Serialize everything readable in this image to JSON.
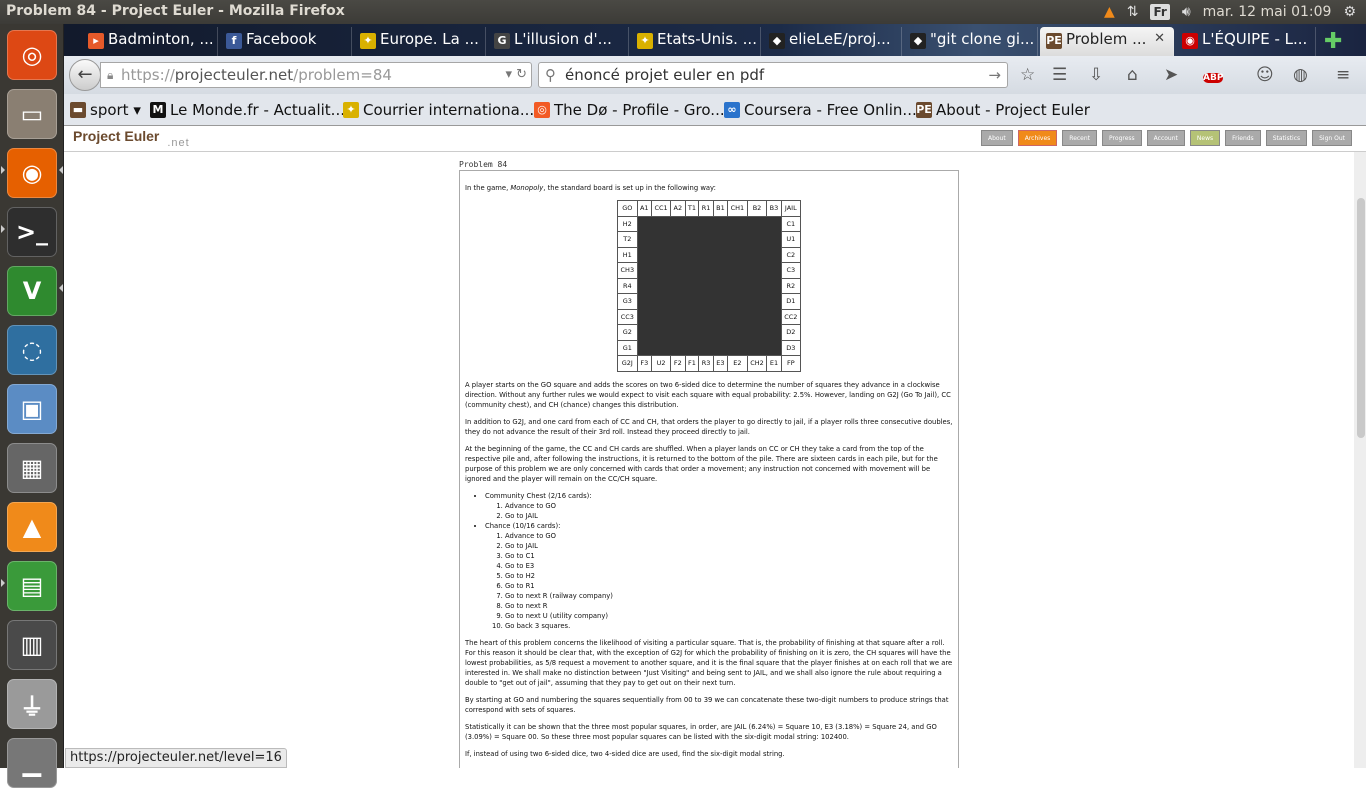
{
  "system": {
    "window_title": "Problem 84 - Project Euler - Mozilla Firefox",
    "keyboard": "Fr",
    "clock": "mar. 12 mai 01:09"
  },
  "launcher": [
    {
      "name": "ubuntu-dash-icon",
      "glyph": "◎",
      "bg": "#dd4814"
    },
    {
      "name": "files-icon",
      "glyph": "▭",
      "bg": "#8a7f72"
    },
    {
      "name": "firefox-icon",
      "glyph": "◉",
      "bg": "#e66000"
    },
    {
      "name": "terminal-icon",
      "glyph": ">_",
      "bg": "#2e2e2e"
    },
    {
      "name": "vim-icon",
      "glyph": "V",
      "bg": "#2f8a2f"
    },
    {
      "name": "network-icon",
      "glyph": "◌",
      "bg": "#2f6fa0"
    },
    {
      "name": "virtualbox-icon",
      "glyph": "▣",
      "bg": "#5b8cc4"
    },
    {
      "name": "calculator-icon",
      "glyph": "▦",
      "bg": "#666"
    },
    {
      "name": "vlc-icon",
      "glyph": "▲",
      "bg": "#f08a1a"
    },
    {
      "name": "spreadsheet-icon",
      "glyph": "▤",
      "bg": "#3a9a3a"
    },
    {
      "name": "workspaces-icon",
      "glyph": "▥",
      "bg": "#4a4a4a"
    },
    {
      "name": "usb-drive-icon",
      "glyph": "⏚",
      "bg": "#9a9a9a"
    },
    {
      "name": "trash-icon",
      "glyph": "▁",
      "bg": "#777"
    }
  ],
  "tabs": [
    {
      "label": "Badminton, ...",
      "fav": "▸",
      "favbg": "#e65a2a"
    },
    {
      "label": "Facebook",
      "fav": "f",
      "favbg": "#3b5998"
    },
    {
      "label": "Europe. La ...",
      "fav": "✦",
      "favbg": "#d9b100"
    },
    {
      "label": "L'illusion d'...",
      "fav": "G",
      "favbg": "#444"
    },
    {
      "label": "Etats-Unis. ...",
      "fav": "✦",
      "favbg": "#d9b100"
    },
    {
      "label": "elieLeE/proj...",
      "fav": "◆",
      "favbg": "#222"
    },
    {
      "label": "\"git clone gi...",
      "fav": "◆",
      "favbg": "#222"
    },
    {
      "label": "Problem ...",
      "fav": "PE",
      "favbg": "#6b4a2e"
    },
    {
      "label": "L'ÉQUIPE - L...",
      "fav": "◉",
      "favbg": "#c00"
    }
  ],
  "url": {
    "prefix": "https://",
    "host": "projecteuler.net",
    "path": "/problem=84"
  },
  "search": {
    "value": "énoncé projet euler en pdf"
  },
  "bookmarks": [
    {
      "label": "sport ▾",
      "fav": "▬",
      "favbg": "#6b4a2e"
    },
    {
      "label": "Le Monde.fr - Actualit...",
      "fav": "M",
      "favbg": "#111"
    },
    {
      "label": "Courrier internationa...",
      "fav": "✦",
      "favbg": "#d9b100"
    },
    {
      "label": "The Dø - Profile - Gro...",
      "fav": "◎",
      "favbg": "#f25a24"
    },
    {
      "label": "Coursera - Free Onlin...",
      "fav": "∞",
      "favbg": "#2a73cc"
    },
    {
      "label": "About - Project Euler",
      "fav": "PE",
      "favbg": "#6b4a2e"
    }
  ],
  "pe": {
    "logo": "Project Euler",
    "logo_net": ".net",
    "nav": [
      "About",
      "Archives",
      "Recent",
      "Progress",
      "Account",
      "News",
      "Friends",
      "Statistics",
      "Sign Out"
    ]
  },
  "problem": {
    "title": "Problem 84",
    "intro": "In the game, Monopoly, the standard board is set up in the following way:",
    "board": {
      "top": [
        "GO",
        "A1",
        "CC1",
        "A2",
        "T1",
        "R1",
        "B1",
        "CH1",
        "B2",
        "B3",
        "JAIL"
      ],
      "left": [
        "H2",
        "T2",
        "H1",
        "CH3",
        "R4",
        "G3",
        "CC3",
        "G2",
        "G1"
      ],
      "right": [
        "C1",
        "U1",
        "C2",
        "C3",
        "R2",
        "D1",
        "CC2",
        "D2",
        "D3"
      ],
      "bottom": [
        "G2J",
        "F3",
        "U2",
        "F2",
        "F1",
        "R3",
        "E3",
        "E2",
        "CH2",
        "E1",
        "FP"
      ]
    },
    "p1": "A player starts on the GO square and adds the scores on two 6-sided dice to determine the number of squares they advance in a clockwise direction. Without any further rules we would expect to visit each square with equal probability: 2.5%. However, landing on G2J (Go To Jail), CC (community chest), and CH (chance) changes this distribution.",
    "p2": "In addition to G2J, and one card from each of CC and CH, that orders the player to go directly to jail, if a player rolls three consecutive doubles, they do not advance the result of their 3rd roll. Instead they proceed directly to jail.",
    "p3": "At the beginning of the game, the CC and CH cards are shuffled. When a player lands on CC or CH they take a card from the top of the respective pile and, after following the instructions, it is returned to the bottom of the pile. There are sixteen cards in each pile, but for the purpose of this problem we are only concerned with cards that order a movement; any instruction not concerned with movement will be ignored and the player will remain on the CC/CH square.",
    "cc_title": "Community Chest (2/16 cards):",
    "cc_items": [
      "Advance to GO",
      "Go to JAIL"
    ],
    "ch_title": "Chance (10/16 cards):",
    "ch_items": [
      "Advance to GO",
      "Go to JAIL",
      "Go to C1",
      "Go to E3",
      "Go to H2",
      "Go to R1",
      "Go to next R (railway company)",
      "Go to next R",
      "Go to next U (utility company)",
      "Go back 3 squares."
    ],
    "p4": "The heart of this problem concerns the likelihood of visiting a particular square. That is, the probability of finishing at that square after a roll. For this reason it should be clear that, with the exception of G2J for which the probability of finishing on it is zero, the CH squares will have the lowest probabilities, as 5/8 request a movement to another square, and it is the final square that the player finishes at on each roll that we are interested in. We shall make no distinction between \"Just Visiting\" and being sent to JAIL, and we shall also ignore the rule about requiring a double to \"get out of jail\", assuming that they pay to get out on their next turn.",
    "p5": "By starting at GO and numbering the squares sequentially from 00 to 39 we can concatenate these two-digit numbers to produce strings that correspond with sets of squares.",
    "p6": "Statistically it can be shown that the three most popular squares, in order, are JAIL (6.24%) = Square 10, E3 (3.18%) = Square 24, and GO (3.09%) = Square 00. So these three most popular squares can be listed with the six-digit modal string: 102400.",
    "p7": "If, instead of using two 6-sided dice, two 4-sided dice are used, find the six-digit modal string."
  },
  "statusbar": "https://projecteuler.net/level=16"
}
